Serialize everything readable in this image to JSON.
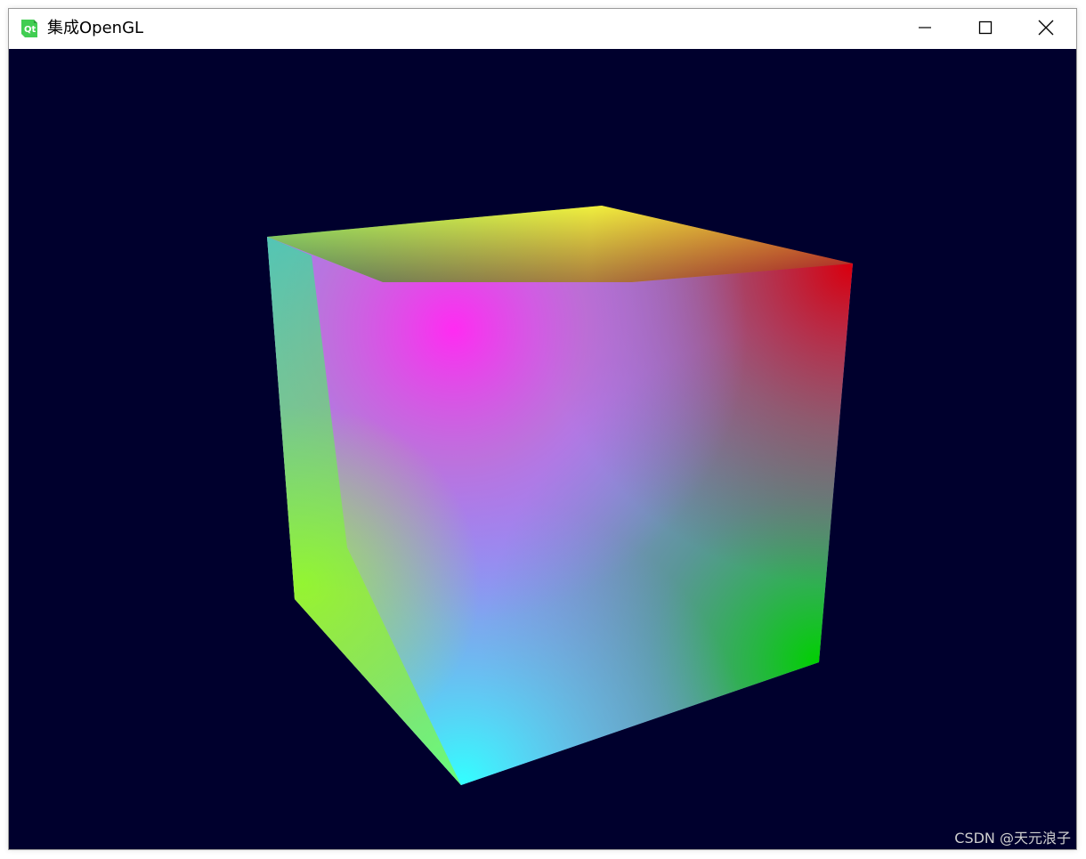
{
  "window": {
    "title": "集成OpenGL",
    "icon": "qt-logo-icon",
    "controls": {
      "minimize_icon": "minimize-icon",
      "maximize_icon": "maximize-icon",
      "close_icon": "close-icon"
    }
  },
  "viewport": {
    "background_color": "#00002d",
    "content": "rgb-color-cube",
    "watermark": "CSDN @天元浪子"
  }
}
